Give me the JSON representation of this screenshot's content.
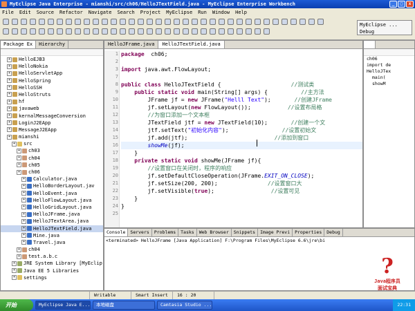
{
  "window": {
    "title": "MyEclipse Java Enterprise - mianshi/src/ch06/HelloJTextField.java - MyEclipse Enterprise Workbench"
  },
  "menu": [
    "File",
    "Edit",
    "Source",
    "Refactor",
    "Navigate",
    "Search",
    "Project",
    "MyEclipse",
    "Run",
    "Window",
    "Help"
  ],
  "perspective": {
    "label": "MyEclipse ...",
    "sub": "Debug"
  },
  "package_explorer": {
    "tabs": [
      "Package Ex",
      "Hierarchy"
    ],
    "items": [
      {
        "label": "HelloEJB3",
        "depth": 1,
        "icon": "proj"
      },
      {
        "label": "HelloNokia",
        "depth": 1,
        "icon": "proj"
      },
      {
        "label": "HelloServletApp",
        "depth": 1,
        "icon": "proj"
      },
      {
        "label": "HelloSpring",
        "depth": 1,
        "icon": "proj"
      },
      {
        "label": "HelloSSH",
        "depth": 1,
        "icon": "proj"
      },
      {
        "label": "HelloStruts",
        "depth": 1,
        "icon": "proj"
      },
      {
        "label": "hf",
        "depth": 1,
        "icon": "proj"
      },
      {
        "label": "javaweb",
        "depth": 1,
        "icon": "proj"
      },
      {
        "label": "kernalMessageConversion",
        "depth": 1,
        "icon": "proj"
      },
      {
        "label": "LoginJ2EApp",
        "depth": 1,
        "icon": "proj"
      },
      {
        "label": "MessageJ2EApp",
        "depth": 1,
        "icon": "proj"
      },
      {
        "label": "mianshi",
        "depth": 1,
        "icon": "proj"
      },
      {
        "label": "src",
        "depth": 2,
        "icon": "fold"
      },
      {
        "label": "ch03",
        "depth": 3,
        "icon": "pkgic"
      },
      {
        "label": "ch04",
        "depth": 3,
        "icon": "pkgic"
      },
      {
        "label": "ch05",
        "depth": 3,
        "icon": "pkgic"
      },
      {
        "label": "ch06",
        "depth": 3,
        "icon": "pkgic"
      },
      {
        "label": "Calculator.java",
        "depth": 4,
        "icon": "java"
      },
      {
        "label": "HelloBorderLayout.jav",
        "depth": 4,
        "icon": "java"
      },
      {
        "label": "HelloEvent.java",
        "depth": 4,
        "icon": "java"
      },
      {
        "label": "HelloFlowLayout.java",
        "depth": 4,
        "icon": "java"
      },
      {
        "label": "HelloGridLayout.java",
        "depth": 4,
        "icon": "java"
      },
      {
        "label": "HelloJFrame.java",
        "depth": 4,
        "icon": "java"
      },
      {
        "label": "HelloJTextArea.java",
        "depth": 4,
        "icon": "java"
      },
      {
        "label": "HelloJTextField.java",
        "depth": 4,
        "icon": "java",
        "selected": true
      },
      {
        "label": "Mine.java",
        "depth": 4,
        "icon": "java"
      },
      {
        "label": "Travel.java",
        "depth": 4,
        "icon": "java"
      },
      {
        "label": "ch04",
        "depth": 3,
        "icon": "pkgic"
      },
      {
        "label": "test.a.b.c",
        "depth": 3,
        "icon": "pkgic"
      },
      {
        "label": "JRE System Library [MyEclip",
        "depth": 2,
        "icon": "lib"
      },
      {
        "label": "Java EE 5 Libraries",
        "depth": 2,
        "icon": "lib"
      },
      {
        "label": "settings",
        "depth": 2,
        "icon": "fold"
      }
    ]
  },
  "editor": {
    "tabs": [
      "HelloJFrame.java",
      "HelloJTextField.java"
    ],
    "active_tab": 1
  },
  "code": [
    {
      "n": "1",
      "segs": [
        [
          "kw",
          "package"
        ],
        [
          "",
          "  ch06;"
        ]
      ]
    },
    {
      "n": "2",
      "segs": []
    },
    {
      "n": "3",
      "segs": [
        [
          "kw",
          "import"
        ],
        [
          "",
          " java.awt.FlowLayout;"
        ]
      ]
    },
    {
      "n": "7",
      "segs": []
    },
    {
      "n": "8",
      "segs": [
        [
          "kw",
          "public class"
        ],
        [
          "",
          " HelloJTextField {                     "
        ],
        [
          "cm",
          "//测试类"
        ]
      ]
    },
    {
      "n": "9",
      "segs": [
        [
          "",
          "    "
        ],
        [
          "kw",
          "public static void"
        ],
        [
          "",
          " main(String[] args) {          "
        ],
        [
          "cm",
          "//主方法"
        ]
      ]
    },
    {
      "n": "10",
      "segs": [
        [
          "",
          "        JFrame jf = "
        ],
        [
          "kw",
          "new"
        ],
        [
          "",
          " JFrame("
        ],
        [
          "str",
          "\"Helll Text\""
        ],
        [
          "",
          ");       "
        ],
        [
          "cm",
          "//创建JFrame"
        ]
      ]
    },
    {
      "n": "11",
      "segs": [
        [
          "",
          "        jf.setLayout("
        ],
        [
          "kw",
          "new"
        ],
        [
          "",
          " FlowLayout());           "
        ],
        [
          "cm",
          "//设置布局格"
        ]
      ]
    },
    {
      "n": "12",
      "segs": [
        [
          "",
          "        "
        ],
        [
          "cm",
          "//为窗口添加一个文本框"
        ]
      ]
    },
    {
      "n": "13",
      "segs": [
        [
          "",
          "        JTextField jtf = "
        ],
        [
          "kw",
          "new"
        ],
        [
          "",
          " JTextField(10);       "
        ],
        [
          "cm",
          "//创建一个文"
        ]
      ]
    },
    {
      "n": "14",
      "segs": [
        [
          "",
          "        jtf.setText("
        ],
        [
          "str",
          "\"初始化内容\""
        ],
        [
          "",
          ");                "
        ],
        [
          "cm",
          "//设置初始文"
        ]
      ]
    },
    {
      "n": "15",
      "segs": [
        [
          "",
          "        jf.add(jtf);                          "
        ],
        [
          "cm",
          "//添加到窗口"
        ]
      ]
    },
    {
      "n": "16",
      "segs": [
        [
          "",
          "        "
        ],
        [
          "it",
          "showMe"
        ],
        [
          "",
          "(jf);"
        ]
      ],
      "hl": true
    },
    {
      "n": "17",
      "segs": [
        [
          "",
          "    }"
        ]
      ]
    },
    {
      "n": "18",
      "segs": [
        [
          "",
          "    "
        ],
        [
          "kw",
          "private static void"
        ],
        [
          "",
          " showMe(JFrame jf){"
        ]
      ]
    },
    {
      "n": "19",
      "segs": [
        [
          "",
          "        "
        ],
        [
          "cm",
          "//设置窗口在关闭时，程序的响应"
        ]
      ]
    },
    {
      "n": "20",
      "segs": [
        [
          "",
          "        jf.setDefaultCloseOperation(JFrame."
        ],
        [
          "it",
          "EXIT_ON_CLOSE"
        ],
        [
          "",
          ");"
        ]
      ]
    },
    {
      "n": "21",
      "segs": [
        [
          "",
          "        jf.setSize(200, 200);               "
        ],
        [
          "cm",
          "//设置窗口大"
        ]
      ]
    },
    {
      "n": "22",
      "segs": [
        [
          "",
          "        jf.setVisible("
        ],
        [
          "kw",
          "true"
        ],
        [
          "",
          ");                 "
        ],
        [
          "cm",
          "//设置可见"
        ]
      ]
    },
    {
      "n": "23",
      "segs": [
        [
          "",
          "    }"
        ]
      ]
    },
    {
      "n": "24",
      "segs": [
        [
          "",
          "}"
        ]
      ]
    },
    {
      "n": "25",
      "segs": []
    }
  ],
  "outline": [
    "ch06",
    "import de",
    "HelloJTex",
    "main(",
    "showM"
  ],
  "console": {
    "tabs": [
      "Console",
      "Servers",
      "Problems",
      "Tasks",
      "Web Browser",
      "Snippets",
      "Image Previ",
      "Properties",
      "Debug"
    ],
    "text": "<terminated> HelloJFrame [Java Application] F:\\Program Files\\MyEclipse 6.6\\jre\\bi"
  },
  "watermark": {
    "q": "?",
    "line1": "Java程序员",
    "line2": "面试宝典"
  },
  "status": {
    "writable": "Writable",
    "insert": "Smart Insert",
    "position": "16 : 20"
  },
  "taskbar": {
    "start": "开始",
    "tasks": [
      "MyEclipse Java E...",
      "本地磁盘",
      "Camtasia Studio ..."
    ],
    "clock": "22:31"
  }
}
